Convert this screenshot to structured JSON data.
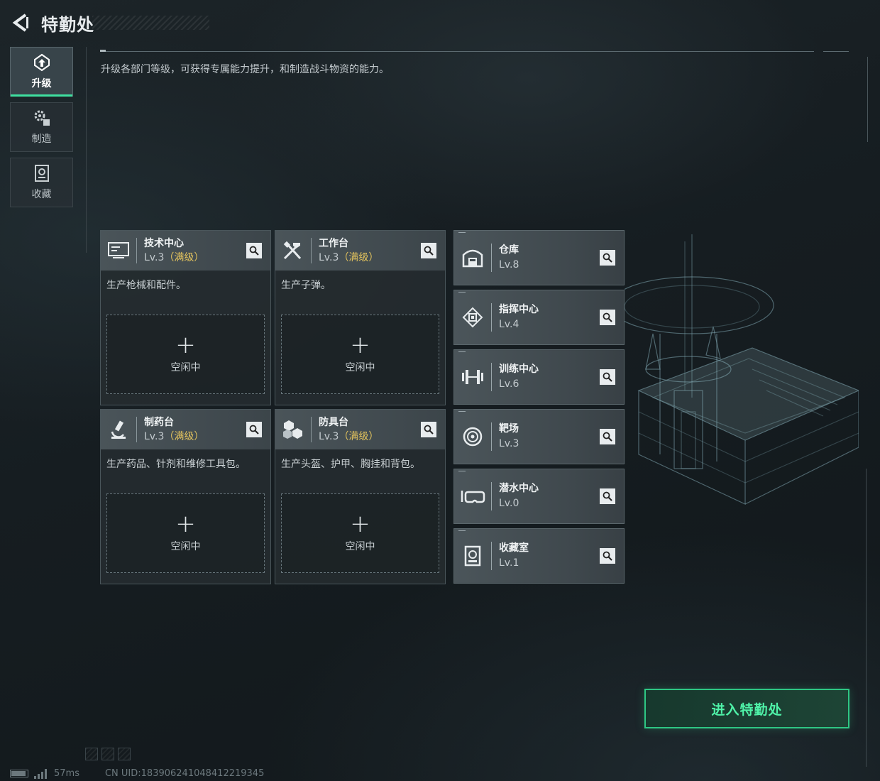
{
  "header": {
    "title": "特勤处"
  },
  "nav": [
    {
      "label": "升级",
      "icon": "upgrade-icon",
      "active": true
    },
    {
      "label": "制造",
      "icon": "gears-icon",
      "active": false
    },
    {
      "label": "收藏",
      "icon": "collection-icon",
      "active": false
    }
  ],
  "description": "升级各部门等级，可获得专属能力提升，和制造战斗物资的能力。",
  "production": [
    {
      "name": "技术中心",
      "level": "Lv.3",
      "max_tag": "（满级）",
      "desc": "生产枪械和配件。",
      "slot_plus": "+",
      "slot_label": "空闲中",
      "icon": "monitor-icon"
    },
    {
      "name": "工作台",
      "level": "Lv.3",
      "max_tag": "（满级）",
      "desc": "生产子弹。",
      "slot_plus": "+",
      "slot_label": "空闲中",
      "icon": "tools-icon"
    },
    {
      "name": "制药台",
      "level": "Lv.3",
      "max_tag": "（满级）",
      "desc": "生产药品、针剂和维修工具包。",
      "slot_plus": "+",
      "slot_label": "空闲中",
      "icon": "microscope-icon"
    },
    {
      "name": "防具台",
      "level": "Lv.3",
      "max_tag": "（满级）",
      "desc": "生产头盔、护甲、胸挂和背包。",
      "slot_plus": "+",
      "slot_label": "空闲中",
      "icon": "blocks-icon"
    }
  ],
  "facilities": [
    {
      "name": "仓库",
      "level": "Lv.8",
      "icon": "warehouse-icon"
    },
    {
      "name": "指挥中心",
      "level": "Lv.4",
      "icon": "chip-icon"
    },
    {
      "name": "训练中心",
      "level": "Lv.6",
      "icon": "dumbbell-icon"
    },
    {
      "name": "靶场",
      "level": "Lv.3",
      "icon": "target-icon"
    },
    {
      "name": "潜水中心",
      "level": "Lv.0",
      "icon": "diving-mask-icon"
    },
    {
      "name": "收藏室",
      "level": "Lv.1",
      "icon": "trophy-case-icon"
    }
  ],
  "enter_button": "进入特勤处",
  "footer": {
    "ping": "57ms",
    "uid": "CN UID:18390624104841221934​5"
  },
  "colors": {
    "accent": "#3fe0a0",
    "max_level": "#e3c35d",
    "enter_text": "#4ff2a8"
  }
}
